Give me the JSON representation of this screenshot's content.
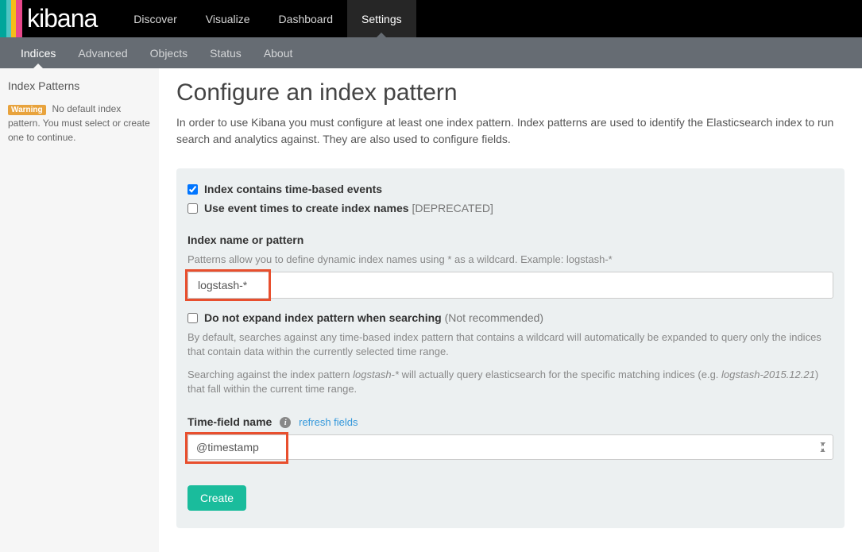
{
  "brand": "kibana",
  "topnav": {
    "items": [
      {
        "label": "Discover"
      },
      {
        "label": "Visualize"
      },
      {
        "label": "Dashboard"
      },
      {
        "label": "Settings"
      }
    ]
  },
  "subnav": {
    "items": [
      {
        "label": "Indices"
      },
      {
        "label": "Advanced"
      },
      {
        "label": "Objects"
      },
      {
        "label": "Status"
      },
      {
        "label": "About"
      }
    ]
  },
  "sidebar": {
    "title": "Index Patterns",
    "warning_badge": "Warning",
    "warning_text": "No default index pattern. You must select or create one to continue."
  },
  "page": {
    "title": "Configure an index pattern",
    "description": "In order to use Kibana you must configure at least one index pattern. Index patterns are used to identify the Elasticsearch index to run search and analytics against. They are also used to configure fields."
  },
  "form": {
    "timebased_label": "Index contains time-based events",
    "timebased_checked": true,
    "eventtimes_label": "Use event times to create index names",
    "eventtimes_deprecated": "[DEPRECATED]",
    "eventtimes_checked": false,
    "index_label": "Index name or pattern",
    "index_hint": "Patterns allow you to define dynamic index names using * as a wildcard. Example: logstash-*",
    "index_value": "logstash-*",
    "noexpand_label": "Do not expand index pattern when searching",
    "noexpand_note": "(Not recommended)",
    "noexpand_checked": false,
    "noexpand_desc1": "By default, searches against any time-based index pattern that contains a wildcard will automatically be expanded to query only the indices that contain data within the currently selected time range.",
    "noexpand_desc2a": "Searching against the index pattern ",
    "noexpand_desc2_em1": "logstash-*",
    "noexpand_desc2b": " will actually query elasticsearch for the specific matching indices (e.g. ",
    "noexpand_desc2_em2": "logstash-2015.12.21",
    "noexpand_desc2c": ") that fall within the current time range.",
    "timefield_label": "Time-field name",
    "timefield_refresh": "refresh fields",
    "timefield_value": "@timestamp",
    "create_label": "Create"
  }
}
